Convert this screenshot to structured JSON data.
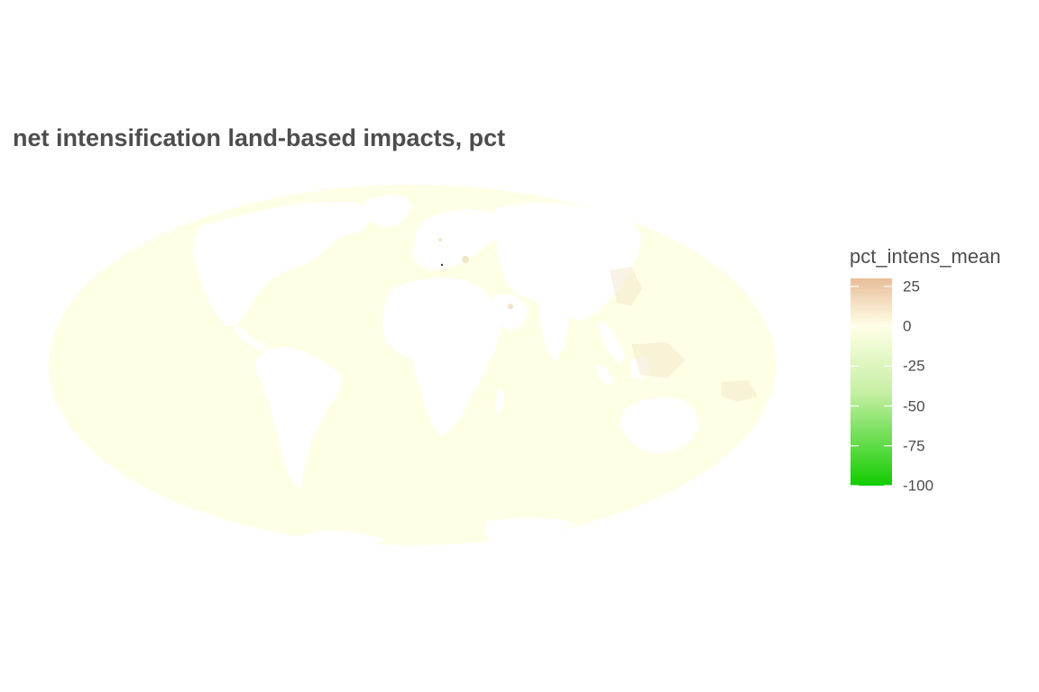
{
  "title": "net intensification land-based impacts, pct",
  "map": {
    "projection": "Mollweide",
    "ocean_fill": "#FFFFE6",
    "land_fill": "#FFFFFF",
    "highlight_fill": "#F0E3C4"
  },
  "legend": {
    "title": "pct_intens_mean",
    "min": -100,
    "max": 30,
    "ticks": [
      {
        "value": 25,
        "label": "25"
      },
      {
        "value": 0,
        "label": "0"
      },
      {
        "value": -25,
        "label": "-25"
      },
      {
        "value": -50,
        "label": "-50"
      },
      {
        "value": -75,
        "label": "-75"
      },
      {
        "value": -100,
        "label": "-100"
      }
    ],
    "colors": {
      "high": "#E8BE9A",
      "mid": "#FFFFE6",
      "low": "#12CC00"
    }
  }
}
